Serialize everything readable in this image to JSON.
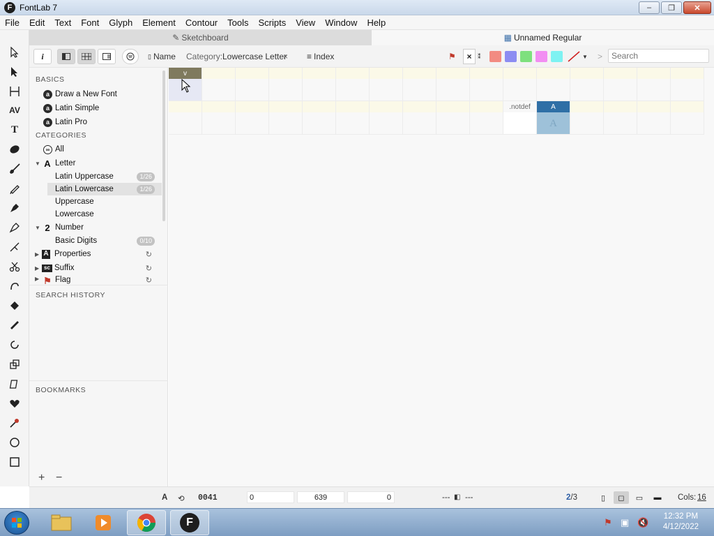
{
  "window": {
    "title": "FontLab 7",
    "logo": "F",
    "minimize_icon": "–",
    "maximize_icon": "❐",
    "close_icon": "✕"
  },
  "menu": [
    "File",
    "Edit",
    "Text",
    "Font",
    "Glyph",
    "Element",
    "Contour",
    "Tools",
    "Scripts",
    "View",
    "Window",
    "Help"
  ],
  "tabs": {
    "sketchboard": "Sketchboard",
    "font": "Unnamed Regular"
  },
  "toolbar": {
    "info_label": "i",
    "name_label": "Name",
    "category_label": "Category:",
    "category_value": "Lowercase Letter",
    "clear_icon": "×",
    "index_label": "Index",
    "search_placeholder": "Search",
    "swatches": [
      "#f28b82",
      "#8c8cf2",
      "#7ee07e",
      "#f28ef2",
      "#7ef2f2"
    ]
  },
  "sidebar": {
    "basics_title": "BASICS",
    "basics": [
      "Draw a New Font",
      "Latin Simple",
      "Latin Pro"
    ],
    "categories_title": "CATEGORIES",
    "all_label": "All",
    "letter_label": "Letter",
    "letter_glyph": "A",
    "latin_uppercase": {
      "label": "Latin Uppercase",
      "count": "1/26"
    },
    "latin_lowercase": {
      "label": "Latin Lowercase",
      "count": "1/26"
    },
    "uppercase": "Uppercase",
    "lowercase": "Lowercase",
    "number_label": "Number",
    "number_glyph": "2",
    "basic_digits": {
      "label": "Basic Digits",
      "count": "0/10"
    },
    "properties_label": "Properties",
    "suffix_label": "Suffix",
    "flag_label": "Flag",
    "search_history_title": "SEARCH HISTORY",
    "bookmarks_title": "BOOKMARKS",
    "add_icon": "+",
    "remove_icon": "−"
  },
  "grid": {
    "selected_cell_label": "v",
    "notdef_label": ".notdef",
    "a_label": "A",
    "a_glyph": "A"
  },
  "status": {
    "glyph_char": "A",
    "unicode": "0041",
    "lsb": "0",
    "width": "639",
    "rsb": "0",
    "dash1": "---",
    "dash2": "---",
    "page": "2",
    "page_total": "/3",
    "cols_label": "Cols:",
    "cols_value": "16"
  },
  "taskbar": {
    "time": "12:32 PM",
    "date": "4/12/2022"
  },
  "colors": {
    "selected_header": "#7f7a5e",
    "a_header": "#2f6fa6",
    "a_body": "#9ec1d9"
  }
}
